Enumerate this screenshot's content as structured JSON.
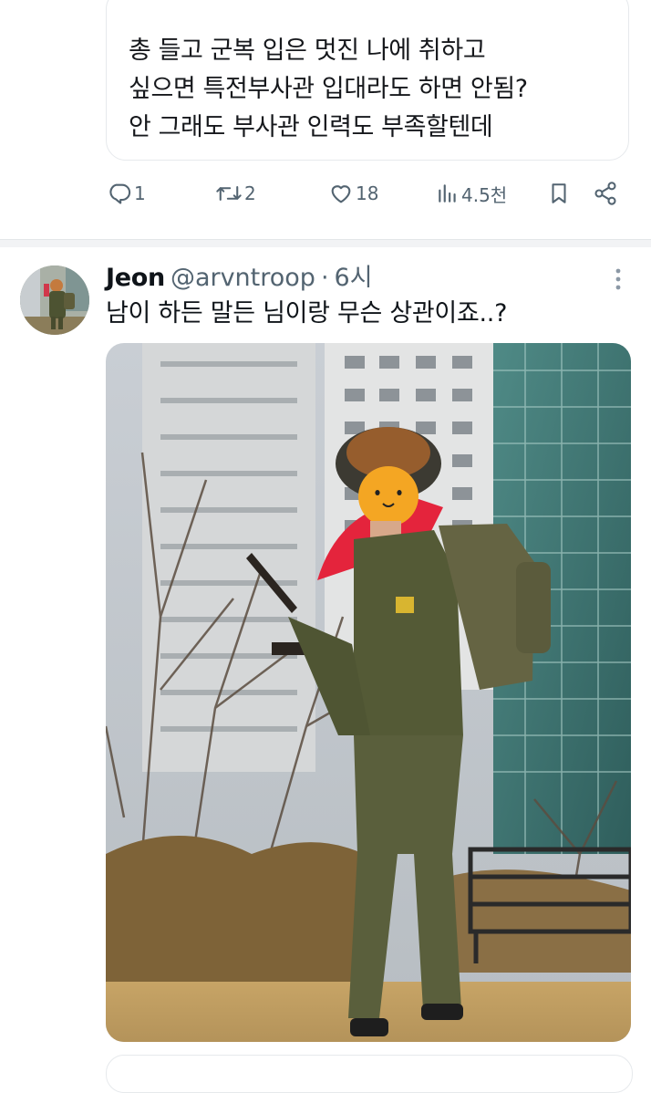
{
  "quoted_tweet": {
    "lines": [
      "총 들고 군복 입은 멋진 나에 취하고",
      "싶으면 특전부사관 입대라도 하면 안됨?",
      "안 그래도 부사관 인력도 부족할텐데"
    ]
  },
  "actions": {
    "reply": {
      "icon": "reply-icon",
      "count": "1"
    },
    "repost": {
      "icon": "repost-icon",
      "count": "2"
    },
    "like": {
      "icon": "heart-icon",
      "count": "18"
    },
    "views": {
      "icon": "views-icon",
      "count": "4.5천"
    },
    "bookmark": {
      "icon": "bookmark-icon"
    },
    "share": {
      "icon": "share-icon"
    }
  },
  "reply_tweet": {
    "display_name": "Jeon",
    "handle": "@arvntroop",
    "separator": "·",
    "time": "6시",
    "text": "남이 하든 말든 님이랑 무슨 상관이죠..?",
    "more_icon": "more-vertical-icon"
  },
  "colors": {
    "text": "#0f1419",
    "secondary": "#536471",
    "border": "#e6e9ec"
  }
}
